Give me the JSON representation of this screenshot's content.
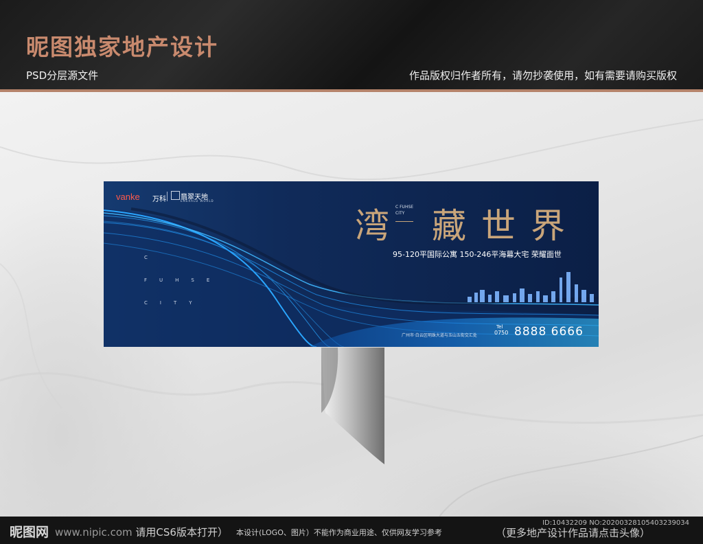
{
  "header": {
    "brand_title": "昵图独家地产设计",
    "psd_label": "PSD分层源文件",
    "copyright": "作品版权归作者所有，请勿抄袭使用，如有需要请购买版权"
  },
  "billboard": {
    "vanke_logo": "vanke",
    "vanke_cn": "万科",
    "emerald_cn": "翡翠天地",
    "emerald_en": "EMERALD WORLD",
    "vertical_letters": [
      "C",
      "FUHSE",
      "CITY"
    ],
    "title_first": "湾",
    "title_rest": "藏世界",
    "cfuhse_line1": "C FUHSE",
    "cfuhse_line2": "CITY",
    "subline": "95-120平国际公寓  150-246平海幕大宅  荣耀面世",
    "address": "广州市·白云区明珠大道与玉山五街交汇处",
    "tel_label": "Tel",
    "area_code": "0750",
    "phone": "8888 6666"
  },
  "footer": {
    "logo": "昵图网",
    "website": "www.nipic.com",
    "open_hint": "请用CS6版本打开）",
    "notice": "本设计(LOGO、图片）不能作为商业用途、仅供网友学习参考",
    "more": "（更多地产设计作品请点击头像）",
    "id_text": "ID:10432209 NO:20200328105403239034"
  },
  "colors": {
    "accent_copper": "#c98a6e",
    "gold": "#c9a57a",
    "navy": "#0b1f46",
    "cyan_line": "#2aa6ff"
  }
}
